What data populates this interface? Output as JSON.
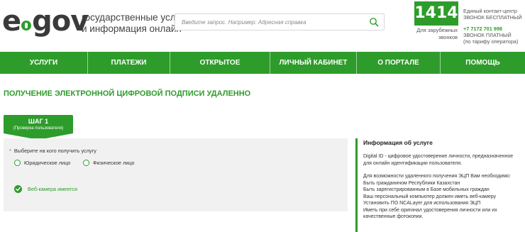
{
  "logo": {
    "left": "e",
    "right": "gov"
  },
  "tagline": {
    "line1": "государственные услуги",
    "line2": "и информация онлайн"
  },
  "search": {
    "placeholder": "Введите запрос. Например: Адресная справка"
  },
  "contact": {
    "short_number": "1414",
    "abroad_line1": "Для зарубежных",
    "abroad_line2": "звонков",
    "center_label": "Единый контакт-центр",
    "free_label": "ЗВОНОК БЕСПЛАТНЫЙ",
    "phone": "+7 7172 701 998",
    "paid_label": "ЗВОНОК ПЛАТНЫЙ",
    "tariff_label": "(по тарифу оператора)"
  },
  "nav": {
    "items": [
      {
        "label": "УСЛУГИ"
      },
      {
        "label": "ПЛАТЕЖИ"
      },
      {
        "label": "ОТКРЫТОЕ ПРАВИТЕЛЬСТВО"
      },
      {
        "label": "ЛИЧНЫЙ КАБИНЕТ"
      },
      {
        "label": "О ПОРТАЛЕ"
      },
      {
        "label": "ПОМОЩЬ"
      }
    ]
  },
  "page_title": "ПОЛУЧЕНИЕ ЭЛЕКТРОННОЙ ЦИФРОВОЙ ПОДПИСИ УДАЛЕННО",
  "step": {
    "title": "ШАГ 1",
    "subtitle": "(Проверка пользователя)"
  },
  "form": {
    "required_mark": "*",
    "prompt": "Выберите на кого получить услугу",
    "options": [
      {
        "label": "Юридическое лицо"
      },
      {
        "label": "Физическое лицо"
      }
    ],
    "webcam_status": "Веб-камера имеется"
  },
  "info": {
    "title": "Информация об услуге",
    "desc_line1": "Digital ID - цифровое удостоверение личности, предназначенное",
    "desc_line2": "для онлайн идентификации пользователя.",
    "req_intro": "Для возможности удаленного получения ЭЦП Вам необходимо:",
    "req1": "Быть гражданином Республики Казахстан",
    "req2": "Быть зарегистрированным в Базе мобильных граждан",
    "req3": "Ваш персональный компьютер должен иметь веб-камеру",
    "req4": "Установить ПО NCALayer для использования ЭЦП",
    "req5_line1": "Иметь при себе оригинал удостоверения личности или их",
    "req5_line2": "качественные фотокопии."
  },
  "colors": {
    "brand_green": "#2e9c2b",
    "panel_gray": "#f1f1f1"
  }
}
